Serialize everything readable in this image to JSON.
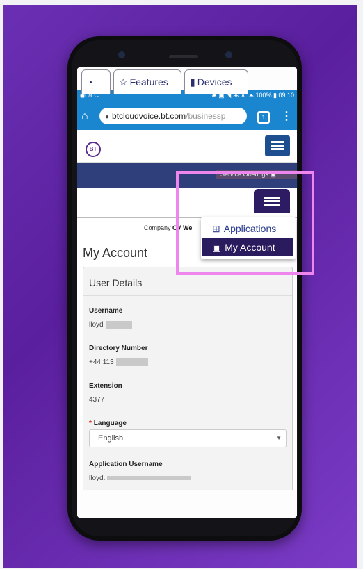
{
  "status_bar": {
    "left_icons": "◉ ⊚ C ...",
    "right_text": "✱ ▣ ◥ ⌘ ⊼ .⏶ 100% ▮ 09:10"
  },
  "browser": {
    "url_main": "btcloudvoice.bt.com",
    "url_rest": "/businessp",
    "tabs_count": "1"
  },
  "site": {
    "logo_text": "BT",
    "service_offerings": "Service Offerings ▣"
  },
  "nav": {
    "features_label": "Features",
    "devices_label": "Devices"
  },
  "dropdown": {
    "applications_label": "Applications",
    "my_account_label": "My Account"
  },
  "company": {
    "prefix": "Company",
    "name": "CV We"
  },
  "page": {
    "title": "My Account"
  },
  "user_details": {
    "heading": "User Details",
    "username_label": "Username",
    "username_value": "lloyd",
    "directory_label": "Directory Number",
    "directory_value": "+44 113",
    "extension_label": "Extension",
    "extension_value": "4377",
    "language_required": "*",
    "language_label": "Language",
    "language_value": "English",
    "app_username_label": "Application Username",
    "app_username_value": "lloyd."
  },
  "colors": {
    "accent_purple": "#2a1a5e",
    "browser_blue": "#1a86d0",
    "highlight_pink": "#ef86ee",
    "background_purple": "#6a2fb3"
  }
}
